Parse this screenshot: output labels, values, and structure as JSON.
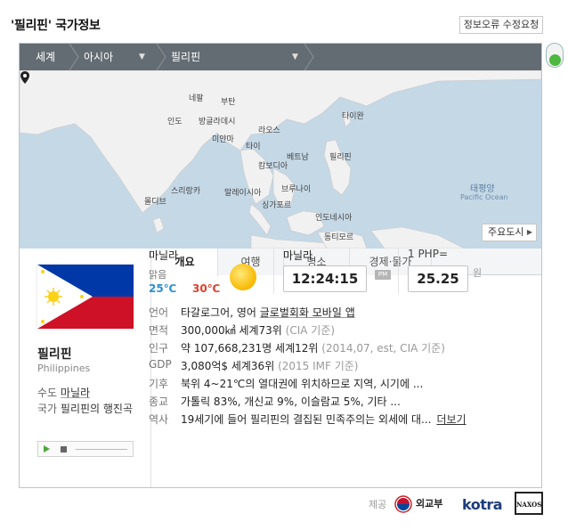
{
  "title": "'필리핀' 국가정보",
  "report_button": "정보오류 수정요청",
  "breadcrumb": {
    "world": "세계",
    "region": "아시아",
    "country": "필리핀"
  },
  "map": {
    "labels": {
      "nepal": "네팔",
      "bhutan": "부탄",
      "india": "인도",
      "bangladesh": "방글라데시",
      "myanmar": "미얀마",
      "laos": "라오스",
      "taiwan": "타이완",
      "thailand": "타이",
      "vietnam": "베트남",
      "cambodia": "캄보디아",
      "philippines": "필리핀",
      "srilanka": "스리랑카",
      "maldives": "몰디브",
      "malaysia": "말레이시아",
      "brunei": "브루나이",
      "singapore": "싱가포르",
      "indonesia": "인도네시아",
      "easttimor": "동티모르",
      "pacific_ko": "태평양",
      "pacific_en": "Pacific Ocean"
    },
    "cities_button": "주요도시"
  },
  "tabs": [
    "개요",
    "여행",
    "명소",
    "경제·물가"
  ],
  "country": {
    "name_ko": "필리핀",
    "name_en": "Philippines",
    "capital_label": "수도",
    "capital": "마닐라",
    "anthem_label": "국가",
    "anthem": "필리핀의 행진곡"
  },
  "weather": {
    "city": "마닐라",
    "desc": "맑음",
    "low": "25℃",
    "high": "30℃",
    "icon": "sun-icon"
  },
  "time": {
    "city": "마닐라",
    "value": "12:24:15",
    "ampm": "PM"
  },
  "exchange": {
    "label": "1 PHP=",
    "value": "25.25",
    "unit": "원"
  },
  "info": [
    {
      "key": "언어",
      "value": "타갈로그어, 영어",
      "link": "글로벌회화 모바일 앱"
    },
    {
      "key": "면적",
      "value": "300,000㎢ 세계73위",
      "aux": "(CIA 기준)"
    },
    {
      "key": "인구",
      "value": "약 107,668,231명 세계12위",
      "aux": "(2014,07, est, CIA 기준)"
    },
    {
      "key": "GDP",
      "value": "3,080억$ 세계36위",
      "aux": "(2015 IMF 기준)"
    },
    {
      "key": "기후",
      "value": "북위 4~21℃의 열대권에 위치하므로 지역, 시기에 ..."
    },
    {
      "key": "종교",
      "value": "가톨릭 83%, 개신교 9%, 이슬람교 5%, 기타 ..."
    },
    {
      "key": "역사",
      "value": "19세기에 들어 필리핀의 결집된 민족주의는 외세에 대...",
      "more": "더보기"
    }
  ],
  "footer": {
    "label": "제공",
    "mofa": "외교부",
    "kotra": "kotra",
    "naxos": "NAXOS"
  },
  "colors": {
    "breadcrumb_bg": "#646c73",
    "map_sea": "#c5d8e6",
    "map_land": "#f1f1f1",
    "temp_low": "#2c8fd0",
    "temp_high": "#e0402c"
  }
}
